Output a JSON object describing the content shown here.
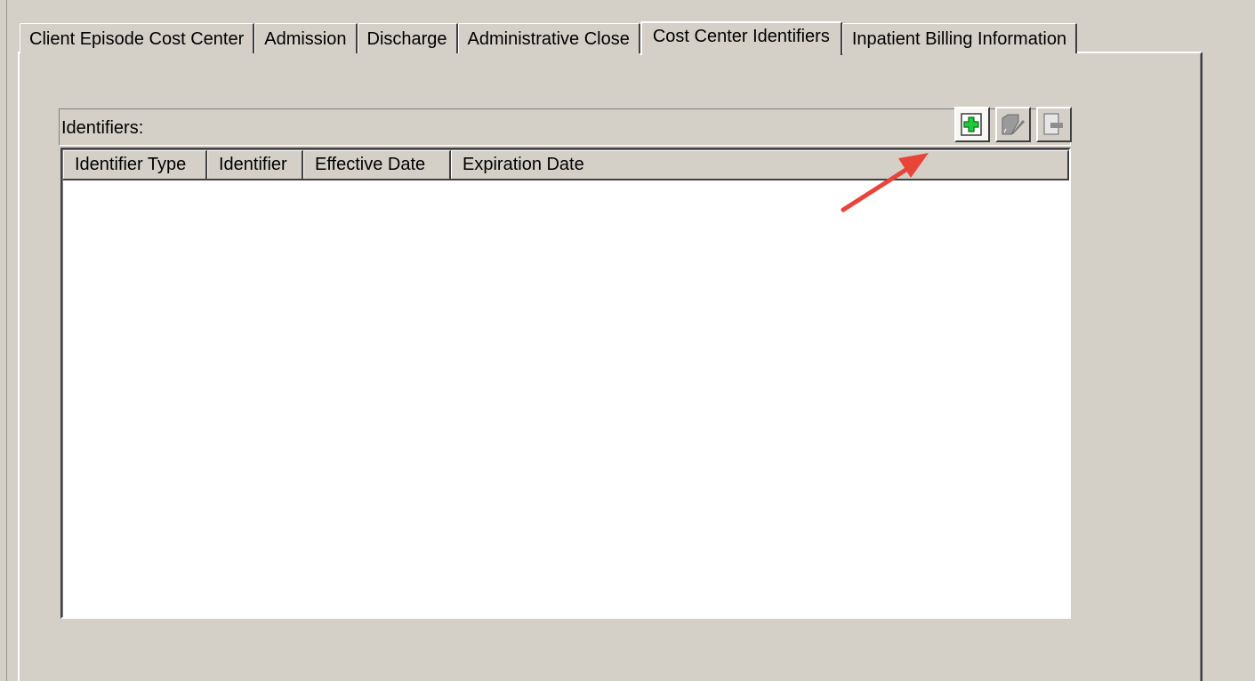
{
  "tabs": [
    {
      "label": "Client Episode Cost Center",
      "active": false
    },
    {
      "label": "Admission",
      "active": false
    },
    {
      "label": "Discharge",
      "active": false
    },
    {
      "label": "Administrative Close",
      "active": false
    },
    {
      "label": "Cost Center Identifiers",
      "active": true
    },
    {
      "label": "Inpatient Billing Information",
      "active": false
    }
  ],
  "identifiers": {
    "label": "Identifiers:",
    "toolbar": [
      {
        "icon": "add-icon",
        "enabled": true
      },
      {
        "icon": "edit-icon",
        "enabled": false
      },
      {
        "icon": "remove-icon",
        "enabled": false
      }
    ],
    "columns": [
      "Identifier Type",
      "Identifier",
      "Effective Date",
      "Expiration Date"
    ],
    "rows": []
  },
  "colors": {
    "background": "#d4d0c8",
    "add_icon_green": "#1fcb3a",
    "annotation_arrow": "#e8443a"
  }
}
